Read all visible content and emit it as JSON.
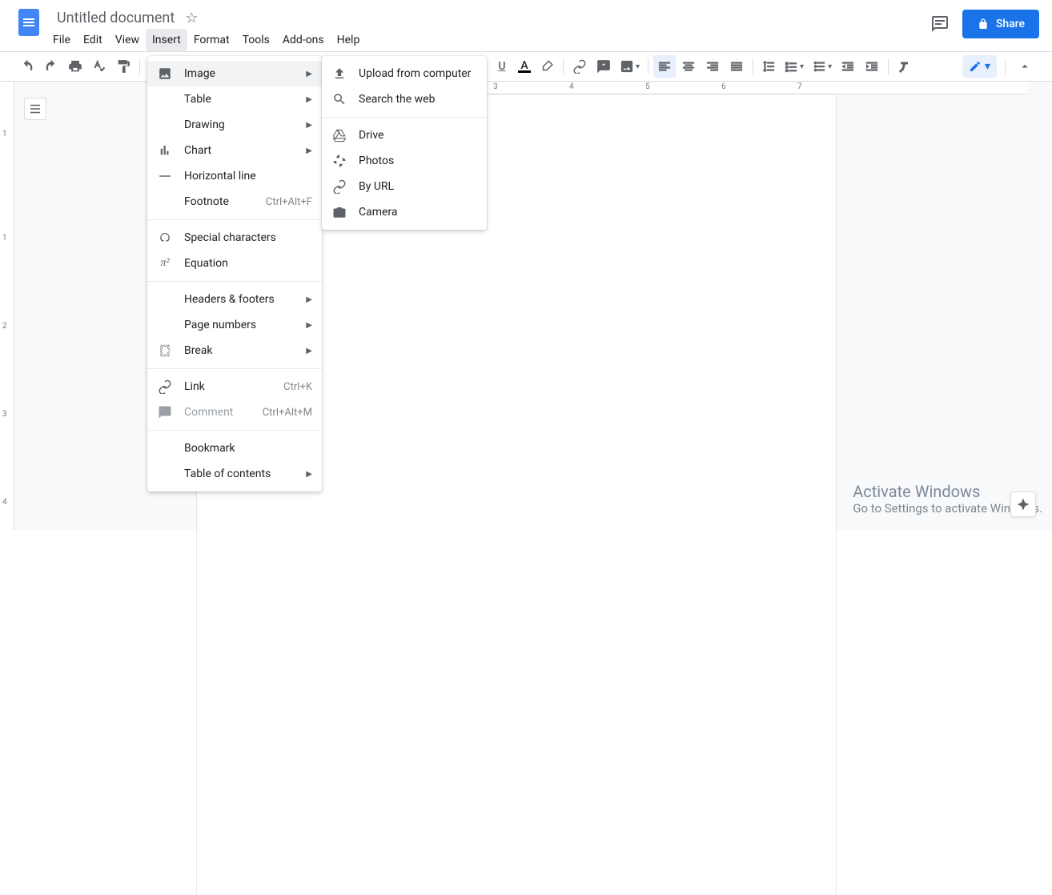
{
  "header": {
    "doc_title": "Untitled document",
    "share_label": "Share"
  },
  "menubar": {
    "items": [
      "File",
      "Edit",
      "View",
      "Insert",
      "Format",
      "Tools",
      "Add-ons",
      "Help"
    ],
    "active_index": 3
  },
  "insert_menu": {
    "items": [
      {
        "icon": "image",
        "label": "Image",
        "arrow": true,
        "highlight": true
      },
      {
        "icon": "table",
        "label": "Table",
        "arrow": true
      },
      {
        "icon": "drawing",
        "label": "Drawing",
        "arrow": true
      },
      {
        "icon": "chart",
        "label": "Chart",
        "arrow": true
      },
      {
        "icon": "hline",
        "label": "Horizontal line"
      },
      {
        "icon": "",
        "label": "Footnote",
        "shortcut": "Ctrl+Alt+F"
      },
      {
        "sep": true
      },
      {
        "icon": "special",
        "label": "Special characters"
      },
      {
        "icon": "equation",
        "label": "Equation"
      },
      {
        "sep": true
      },
      {
        "icon": "",
        "label": "Headers & footers",
        "arrow": true
      },
      {
        "icon": "",
        "label": "Page numbers",
        "arrow": true
      },
      {
        "icon": "break",
        "label": "Break",
        "arrow": true
      },
      {
        "sep": true
      },
      {
        "icon": "link",
        "label": "Link",
        "shortcut": "Ctrl+K"
      },
      {
        "icon": "comment",
        "label": "Comment",
        "shortcut": "Ctrl+Alt+M",
        "disabled": true
      },
      {
        "sep": true
      },
      {
        "icon": "",
        "label": "Bookmark"
      },
      {
        "icon": "",
        "label": "Table of contents",
        "arrow": true
      }
    ]
  },
  "image_submenu": {
    "items": [
      {
        "icon": "upload",
        "label": "Upload from computer"
      },
      {
        "icon": "search",
        "label": "Search the web"
      },
      {
        "sep": true
      },
      {
        "icon": "drive",
        "label": "Drive"
      },
      {
        "icon": "photos",
        "label": "Photos"
      },
      {
        "icon": "url",
        "label": "By URL"
      },
      {
        "icon": "camera",
        "label": "Camera"
      }
    ]
  },
  "ruler": {
    "h_numbers": [
      "3",
      "4",
      "5",
      "6",
      "7"
    ],
    "v_numbers": [
      "1",
      "1",
      "2",
      "3",
      "4"
    ]
  },
  "watermark": {
    "title": "Activate Windows",
    "sub": "Go to Settings to activate Windows."
  }
}
